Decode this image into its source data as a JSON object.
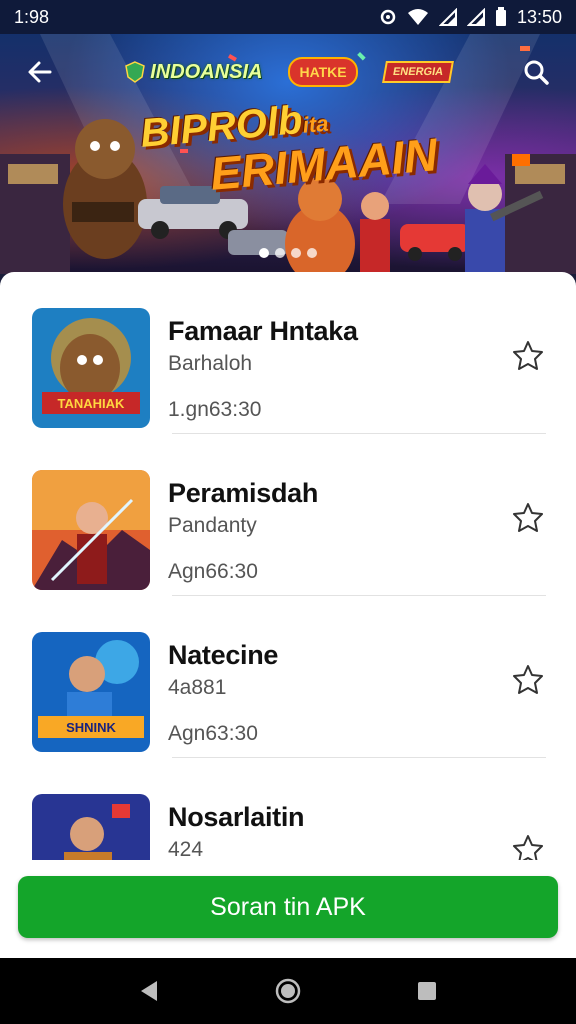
{
  "status_bar": {
    "left_time": "1:98",
    "right_time": "13:50",
    "icons": [
      "sync-icon",
      "wifi-icon",
      "signal-icon",
      "signal-icon",
      "battery-icon"
    ]
  },
  "banner": {
    "logo_main": "INDOANSIA",
    "logo_badge": "HATKE",
    "logo_third": "ENERGIA",
    "title_line1": "BIPROlb",
    "title_line1_suffix": "ita",
    "title_line2": "ERIMAAIN",
    "carousel": {
      "count": 4,
      "active": 0
    },
    "icons": {
      "back": "arrow-left-icon",
      "search": "search-icon"
    }
  },
  "list": {
    "items": [
      {
        "title": "Famaar Hntaka",
        "subtitle": "Barhaloh",
        "meta": "1.gn63:30",
        "thumb_text": "TANAHIAK",
        "fav_icon": "star-outline-icon"
      },
      {
        "title": "Peramisdah",
        "subtitle": "Pandanty",
        "meta": "Agn66:30",
        "thumb_text": "",
        "fav_icon": "star-outline-icon"
      },
      {
        "title": "Natecine",
        "subtitle": "4a881",
        "meta": "Agn63:30",
        "thumb_text": "SHNINK",
        "fav_icon": "star-outline-icon"
      },
      {
        "title": "Nosarlaitin",
        "subtitle": "424",
        "meta": "",
        "thumb_text": "",
        "fav_icon": "star-outline-icon"
      }
    ]
  },
  "cta": {
    "label": "Soran tin APK"
  },
  "nav": {
    "icons": [
      "back-triangle-icon",
      "home-circle-icon",
      "recents-square-icon"
    ]
  },
  "colors": {
    "accent": "#14a52a",
    "banner_title": "#ffcf33",
    "status_bg": "#0f1a3a"
  }
}
